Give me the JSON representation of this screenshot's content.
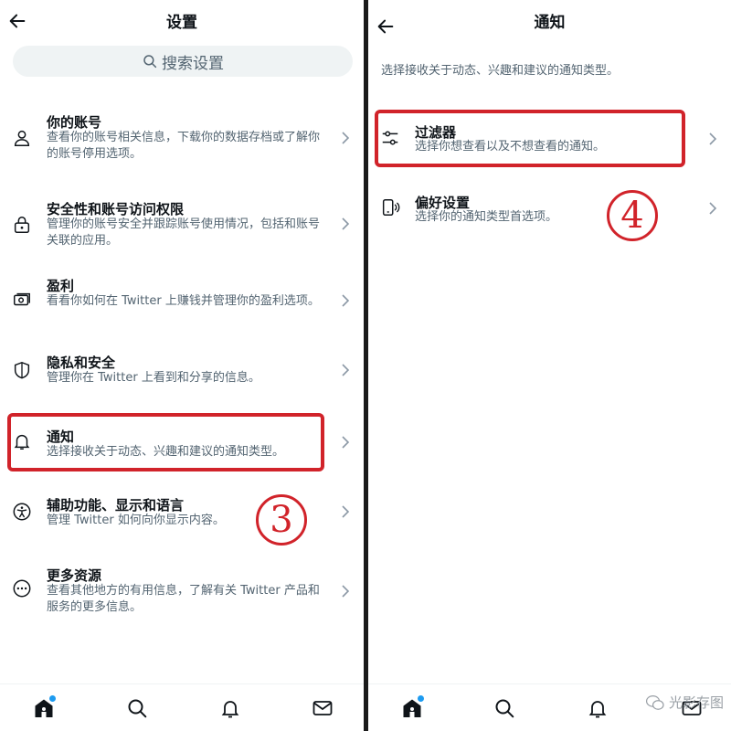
{
  "left": {
    "title": "设置",
    "search_placeholder": "搜索设置",
    "items": [
      {
        "title": "你的账号",
        "desc": "查看你的账号相关信息，下载你的数据存档或了解你的账号停用选项。",
        "icon": "person-icon"
      },
      {
        "title": "安全性和账号访问权限",
        "desc": "管理你的账号安全并跟踪账号使用情况，包括和账号关联的应用。",
        "icon": "lock-icon"
      },
      {
        "title": "盈利",
        "desc": "看看你如何在 Twitter 上赚钱并管理你的盈利选项。",
        "icon": "money-icon"
      },
      {
        "title": "隐私和安全",
        "desc": "管理你在 Twitter 上看到和分享的信息。",
        "icon": "shield-icon"
      },
      {
        "title": "通知",
        "desc": "选择接收关于动态、兴趣和建议的通知类型。",
        "icon": "bell-icon"
      },
      {
        "title": "辅助功能、显示和语言",
        "desc": "管理 Twitter 如何向你显示内容。",
        "icon": "accessibility-icon"
      },
      {
        "title": "更多资源",
        "desc": "查看其他地方的有用信息，了解有关 Twitter 产品和服务的更多信息。",
        "icon": "more-icon"
      }
    ],
    "step_number": "3"
  },
  "right": {
    "title": "通知",
    "intro": "选择接收关于动态、兴趣和建议的通知类型。",
    "items": [
      {
        "title": "过滤器",
        "desc": "选择你想查看以及不想查看的通知。",
        "icon": "filter-sliders-icon"
      },
      {
        "title": "偏好设置",
        "desc": "选择你的通知类型首选项。",
        "icon": "device-sound-icon"
      }
    ],
    "step_number": "4"
  },
  "tabs": [
    "home-icon",
    "search-icon",
    "bell-icon",
    "mail-icon"
  ],
  "watermark": "光影存图",
  "colors": {
    "highlight": "#d1232a",
    "accent": "#1d9bf0",
    "secondary_text": "#536471"
  }
}
